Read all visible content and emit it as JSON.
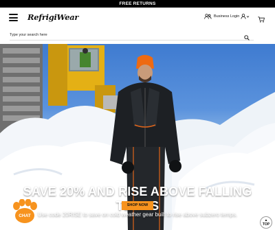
{
  "promo": {
    "text": "FREE RETURNS"
  },
  "header": {
    "logo_text": "RefrigiWear",
    "business_login_label": "Business Login",
    "menu_icon": "hamburger-menu-icon",
    "account_icon": "user-icon",
    "cart_icon": "cart-icon"
  },
  "search": {
    "placeholder": "Type your search here",
    "icon": "search-icon"
  },
  "hero": {
    "headline": "SAVE 20% AND RISE ABOVE FALLING TEMPS",
    "cta_label": "SHOP NOW",
    "subline": "Use code 20RISE to save on cold weather gear built to rise above subzero temps."
  },
  "chat": {
    "label": "CHAT",
    "icon": "paw-icon"
  },
  "back_to_top": {
    "label": "TOP",
    "icon": "chevron-up-icon"
  },
  "colors": {
    "cta_orange": "#f7931e",
    "promo_bar": "#000000",
    "sky_blue": "#4a86d6"
  }
}
